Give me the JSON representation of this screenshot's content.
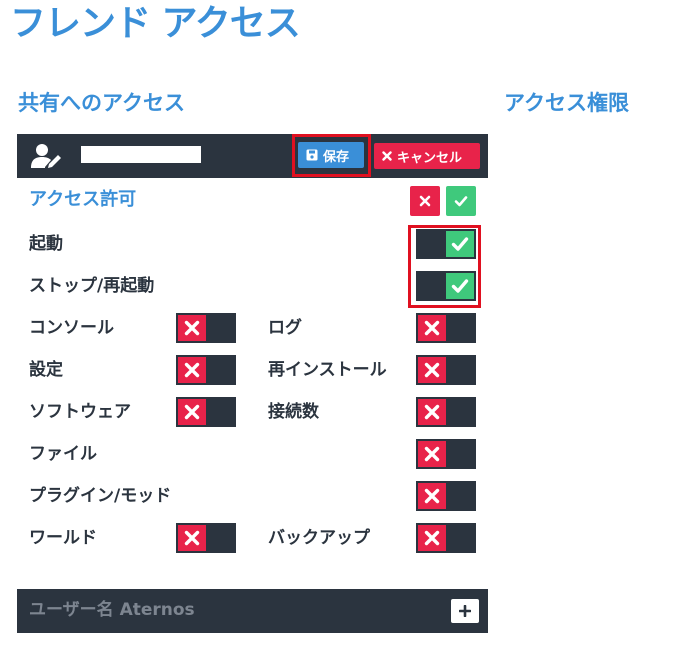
{
  "page": {
    "title": "フレンド アクセス"
  },
  "sections": {
    "share_title": "共有へのアクセス",
    "perm_title": "アクセス権限"
  },
  "user_bar": {
    "username": "",
    "save_label": "保存",
    "cancel_label": "キャンセル"
  },
  "permissions": {
    "header_label": "アクセス許可",
    "items": [
      {
        "label": "起動",
        "state": "on"
      },
      {
        "label": "ストップ/再起動",
        "state": "on"
      },
      {
        "label": "コンソール",
        "state": "off"
      },
      {
        "label": "ログ",
        "state": "off"
      },
      {
        "label": "設定",
        "state": "off"
      },
      {
        "label": "再インストール",
        "state": "off"
      },
      {
        "label": "ソフトウェア",
        "state": "off"
      },
      {
        "label": "接続数",
        "state": "off"
      },
      {
        "label": "ファイル",
        "state": "off"
      },
      {
        "label": "プラグイン/モッド",
        "state": "off"
      },
      {
        "label": "ワールド",
        "state": "off"
      },
      {
        "label": "バックアップ",
        "state": "off"
      }
    ]
  },
  "add_user": {
    "placeholder": "ユーザー名 Aternos"
  },
  "colors": {
    "accent": "#3a8fd8",
    "dark": "#2b343f",
    "deny": "#e8234a",
    "allow": "#3fc97c",
    "highlight": "#e01020"
  }
}
